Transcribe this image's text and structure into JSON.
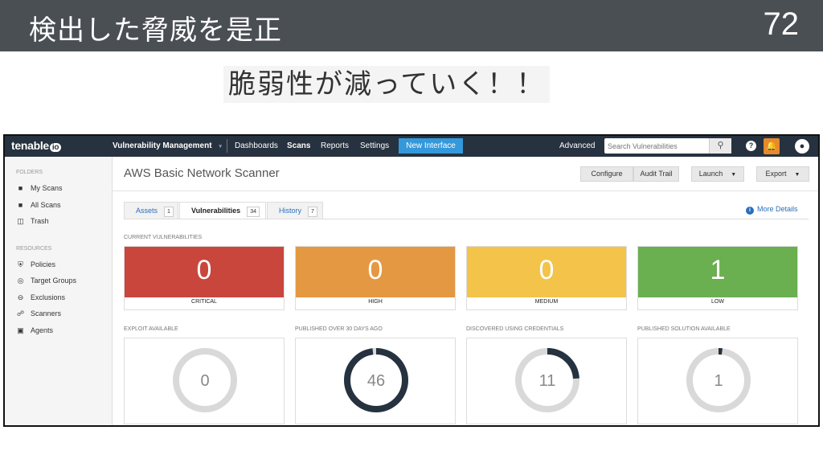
{
  "slide": {
    "title": "検出した脅威を是正",
    "number": "72",
    "subtitle": "脆弱性が減っていく！！"
  },
  "topbar": {
    "logo": "tenable",
    "logo_badge": "io",
    "product": "Vulnerability Management",
    "nav": [
      "Dashboards",
      "Scans",
      "Reports",
      "Settings"
    ],
    "active_nav": "Scans",
    "new_interface": "New Interface",
    "advanced": "Advanced",
    "search_placeholder": "Search Vulnerabilities",
    "icons": [
      "search-icon",
      "help-icon",
      "bell-icon",
      "user-icon"
    ]
  },
  "sidebar": {
    "folders_heading": "FOLDERS",
    "folders": [
      "My Scans",
      "All Scans",
      "Trash"
    ],
    "resources_heading": "RESOURCES",
    "resources": [
      "Policies",
      "Target Groups",
      "Exclusions",
      "Scanners",
      "Agents"
    ]
  },
  "main": {
    "title": "AWS Basic Network Scanner",
    "actions": {
      "configure": "Configure",
      "audit_trail": "Audit Trail",
      "launch": "Launch",
      "export": "Export"
    },
    "tabs": [
      {
        "label": "Assets",
        "count": "1"
      },
      {
        "label": "Vulnerabilities",
        "count": "34"
      },
      {
        "label": "History",
        "count": "7"
      }
    ],
    "more_details": "More Details",
    "current_heading": "CURRENT VULNERABILITIES",
    "severity": [
      {
        "label": "CRITICAL",
        "value": "0",
        "color": "#c9463d"
      },
      {
        "label": "HIGH",
        "value": "0",
        "color": "#e59842"
      },
      {
        "label": "MEDIUM",
        "value": "0",
        "color": "#f4c349"
      },
      {
        "label": "LOW",
        "value": "1",
        "color": "#6aaf50"
      }
    ],
    "metrics": [
      {
        "label": "EXPLOIT AVAILABLE",
        "value": "0",
        "fraction": 0.0
      },
      {
        "label": "PUBLISHED OVER 30 DAYS AGO",
        "value": "46",
        "fraction": 0.98
      },
      {
        "label": "DISCOVERED USING CREDENTIALS",
        "value": "11",
        "fraction": 0.24
      },
      {
        "label": "PUBLISHED SOLUTION AVAILABLE",
        "value": "1",
        "fraction": 0.02
      }
    ],
    "donut_colors": {
      "track": "#d9d9d9",
      "fill": "#26323f"
    }
  }
}
